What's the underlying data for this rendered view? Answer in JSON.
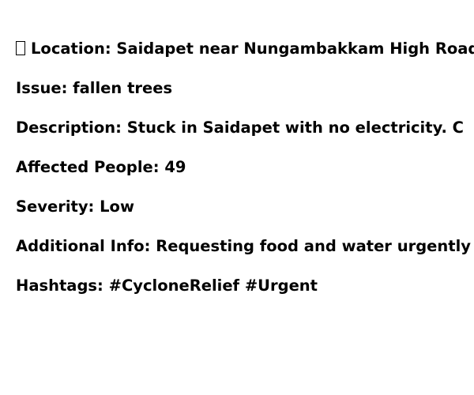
{
  "report": {
    "location_label": "Location: Saidapet near Nungambakkam High Road",
    "issue": "Issue: fallen trees",
    "description": "Description: Stuck in Saidapet with no electricity. C",
    "affected_people": "Affected People: 49",
    "severity": "Severity: Low",
    "additional_info": "Additional Info: Requesting food and water urgently",
    "hashtags": "Hashtags: #CycloneRelief #Urgent"
  },
  "icons": {
    "location": "map-pin-icon"
  }
}
